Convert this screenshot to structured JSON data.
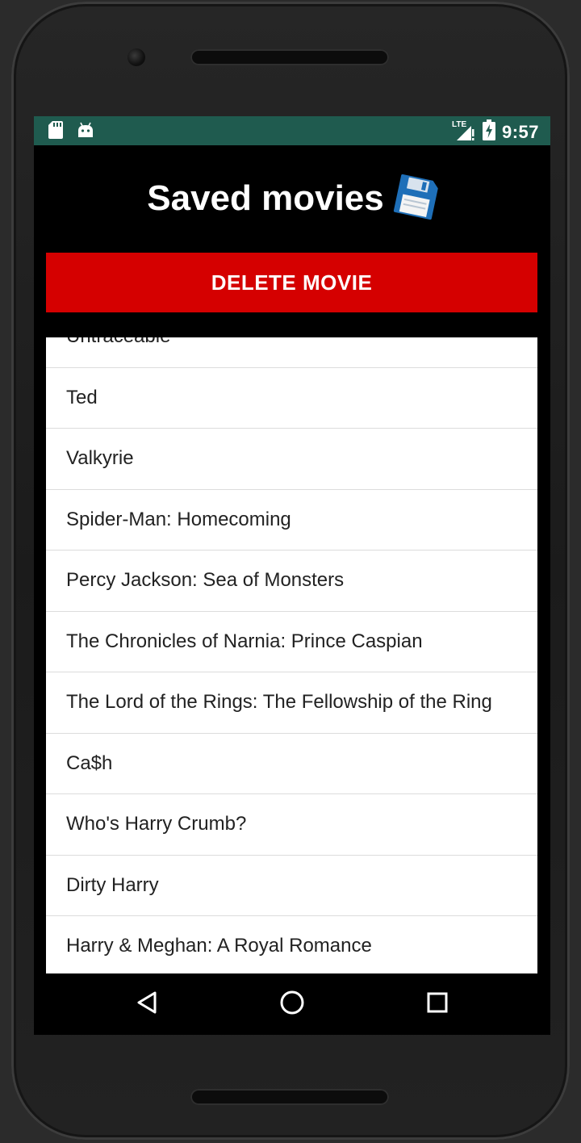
{
  "status_bar": {
    "time": "9:57",
    "network": "LTE",
    "icons": [
      "sd-card-icon",
      "android-icon",
      "signal-icon",
      "battery-charging-icon"
    ]
  },
  "app": {
    "title": "Saved movies",
    "title_icon": "floppy-disk-icon",
    "delete_button_label": "DELETE MOVIE"
  },
  "movies": [
    "Untraceable",
    "Ted",
    "Valkyrie",
    "Spider-Man: Homecoming",
    "Percy Jackson: Sea of Monsters",
    "The Chronicles of Narnia: Prince Caspian",
    "The Lord of the Rings: The Fellowship of the Ring",
    "Ca$h",
    "Who's Harry Crumb?",
    "Dirty Harry",
    "Harry & Meghan: A Royal Romance"
  ],
  "nav_bar": {
    "icons": [
      "back-icon",
      "home-icon",
      "recents-icon"
    ]
  },
  "colors": {
    "status_bar": "#1f5b4f",
    "delete_button": "#d50000",
    "app_background": "#000000",
    "list_background": "#ffffff"
  }
}
